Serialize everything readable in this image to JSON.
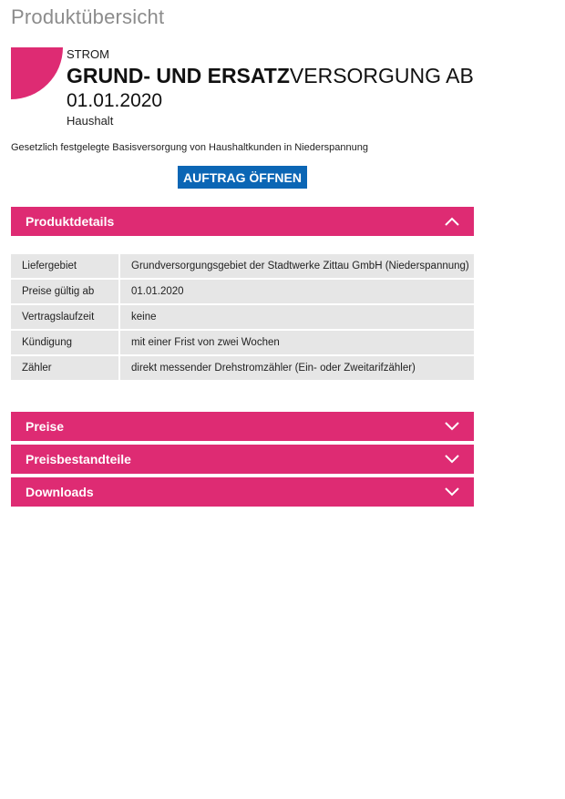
{
  "page": {
    "title": "Produktübersicht"
  },
  "product": {
    "category": "STROM",
    "name_bold": "GRUND- UND ERSATZ",
    "name_regular": "VERSORGUNG AB",
    "date": "01.01.2020",
    "segment": "Haushalt",
    "description": "Gesetzlich festgelegte Basisversorgung von Haushaltkunden in Niederspannung",
    "order_button": "AUFTRAG ÖFFNEN"
  },
  "sections": {
    "details": {
      "title": "Produktdetails",
      "rows": [
        {
          "key": "Liefergebiet",
          "value": "Grundversorgungsgebiet der Stadtwerke Zittau GmbH (Niederspannung)"
        },
        {
          "key": "Preise gültig ab",
          "value": "01.01.2020"
        },
        {
          "key": "Vertragslaufzeit",
          "value": "keine"
        },
        {
          "key": "Kündigung",
          "value": "mit einer Frist von zwei Wochen"
        },
        {
          "key": "Zähler",
          "value": "direkt messender Drehstromzähler (Ein- oder Zweitarifzähler)"
        }
      ]
    },
    "prices": {
      "title": "Preise"
    },
    "price_components": {
      "title": "Preisbestandteile"
    },
    "downloads": {
      "title": "Downloads"
    }
  },
  "icons": {
    "logo": "quarter-circle-logo",
    "expanded": "chevron-up-icon",
    "collapsed": "chevron-down-icon"
  },
  "colors": {
    "accent": "#de2b73",
    "button": "#0b66b5",
    "title_gray": "#8c8c8c",
    "table_bg": "#e6e6e6"
  }
}
